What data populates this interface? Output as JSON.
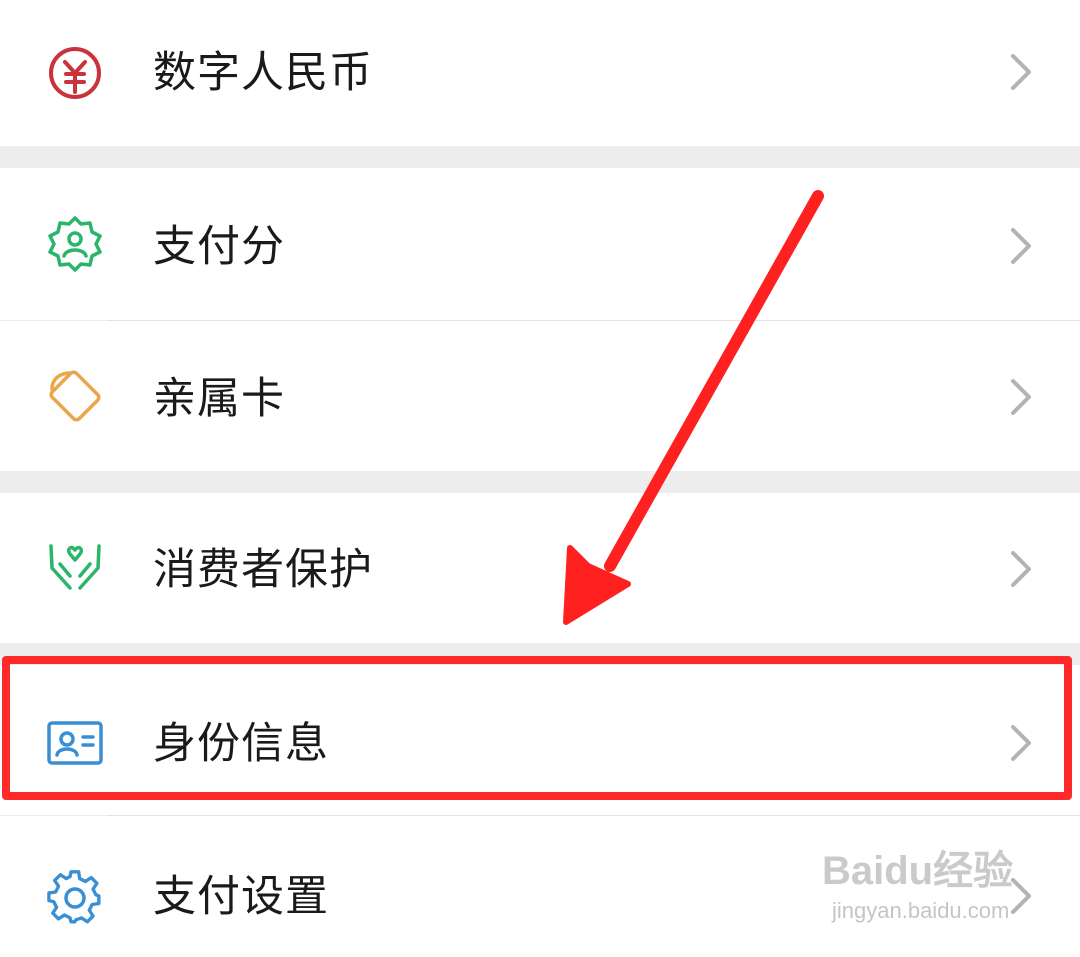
{
  "menu": {
    "items": [
      {
        "label": "数字人民币",
        "icon": "digital-rmb-icon"
      },
      {
        "label": "支付分",
        "icon": "pay-score-icon"
      },
      {
        "label": "亲属卡",
        "icon": "family-card-icon"
      },
      {
        "label": "消费者保护",
        "icon": "consumer-protection-icon"
      },
      {
        "label": "身份信息",
        "icon": "id-card-icon"
      },
      {
        "label": "支付设置",
        "icon": "gear-icon"
      }
    ]
  },
  "annotation": {
    "highlighted_item": "身份信息",
    "color": "#ff2a2a"
  },
  "watermark": {
    "brand": "Baidu经验",
    "url": "jingyan.baidu.com"
  }
}
